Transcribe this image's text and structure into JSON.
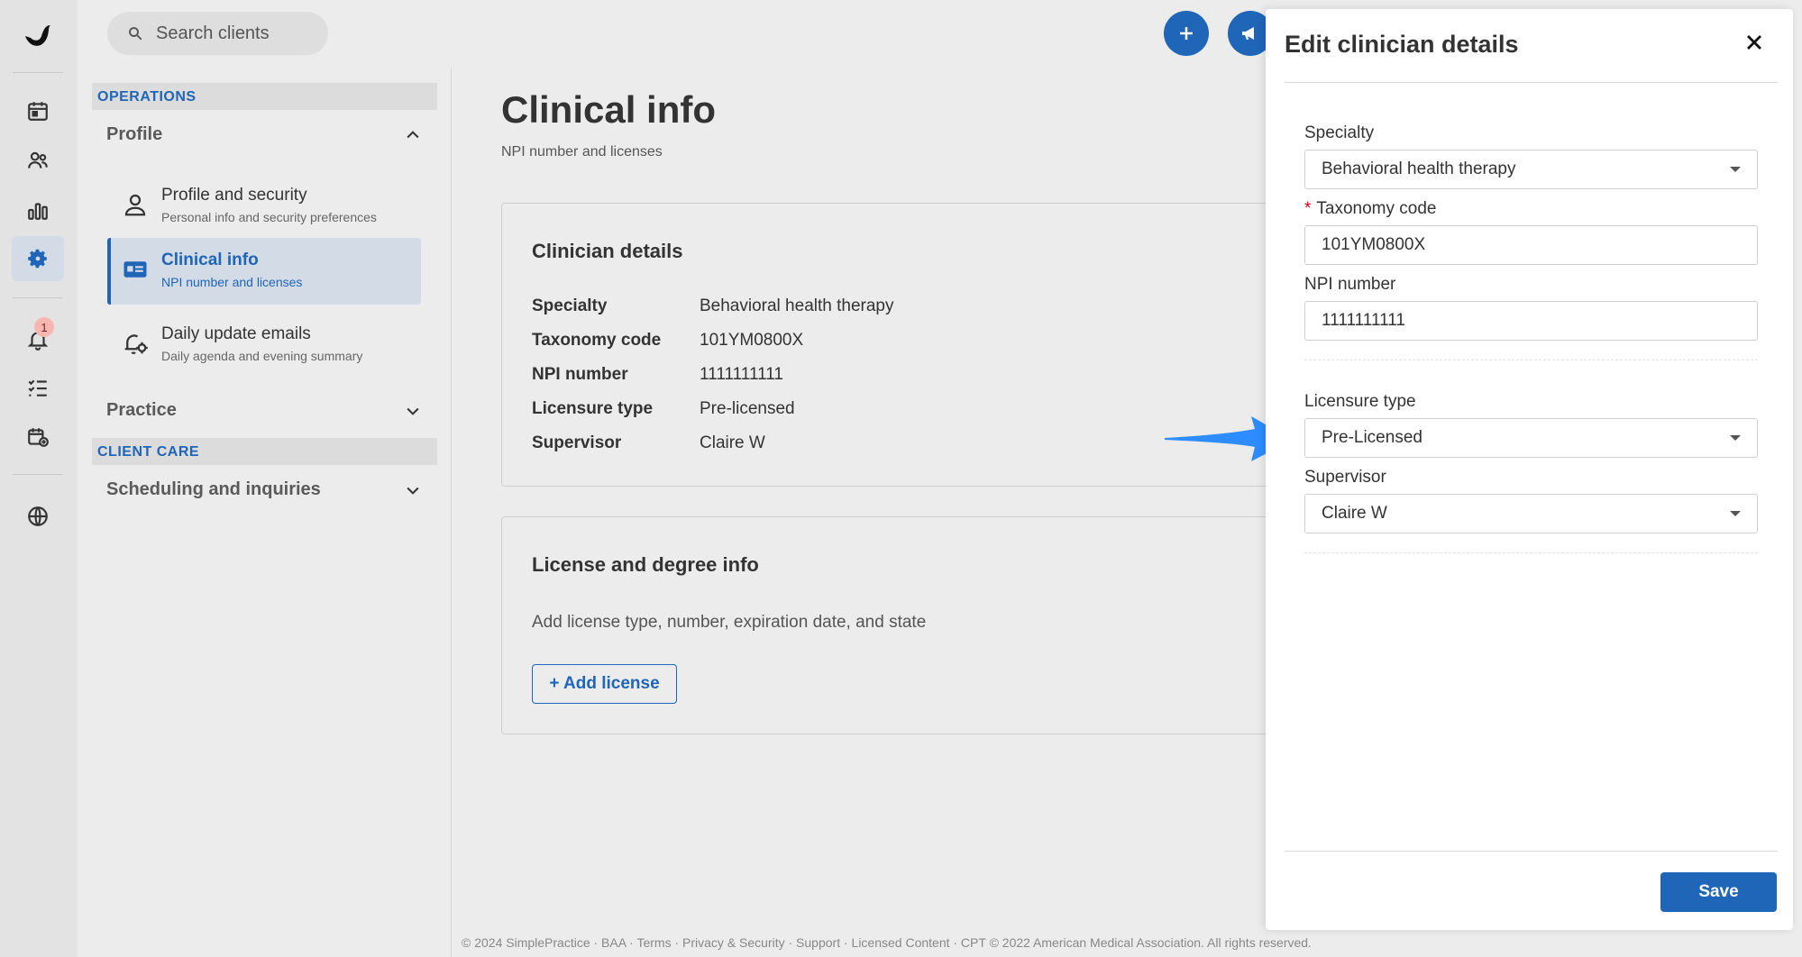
{
  "search": {
    "placeholder": "Search clients"
  },
  "subnav": {
    "operations_header": "OPERATIONS",
    "profile_group": "Profile",
    "items": [
      {
        "title": "Profile and security",
        "subtitle": "Personal info and security preferences"
      },
      {
        "title": "Clinical info",
        "subtitle": "NPI number and licenses"
      },
      {
        "title": "Daily update emails",
        "subtitle": "Daily agenda and evening summary"
      }
    ],
    "practice_group": "Practice",
    "client_care_header": "CLIENT CARE",
    "scheduling_group": "Scheduling and inquiries"
  },
  "rail": {
    "notification_count": "1"
  },
  "main": {
    "title": "Clinical info",
    "subtitle": "NPI number and licenses",
    "clinician_card": {
      "heading": "Clinician details",
      "rows": [
        {
          "label": "Specialty",
          "value": "Behavioral health therapy"
        },
        {
          "label": "Taxonomy code",
          "value": "101YM0800X"
        },
        {
          "label": "NPI number",
          "value": "1111111111"
        },
        {
          "label": "Licensure type",
          "value": "Pre-licensed"
        },
        {
          "label": "Supervisor",
          "value": "Claire W"
        }
      ]
    },
    "license_card": {
      "heading": "License and degree info",
      "hint": "Add license type, number, expiration date, and state",
      "add_button": "+ Add license"
    }
  },
  "footer": "© 2024 SimplePractice · BAA · Terms · Privacy & Security · Support · Licensed Content · CPT © 2022 American Medical Association. All rights reserved.",
  "drawer": {
    "title": "Edit clinician details",
    "specialty_label": "Specialty",
    "specialty_value": "Behavioral health therapy",
    "taxonomy_label": "Taxonomy code",
    "taxonomy_required": "*",
    "taxonomy_value": "101YM0800X",
    "npi_label": "NPI number",
    "npi_value": "1111111111",
    "licensure_label": "Licensure type",
    "licensure_value": "Pre-Licensed",
    "supervisor_label": "Supervisor",
    "supervisor_value": "Claire W",
    "save_label": "Save"
  },
  "colors": {
    "accent": "#1f65b8",
    "arrow": "#2d8cff",
    "badge": "#f6b7b0"
  }
}
